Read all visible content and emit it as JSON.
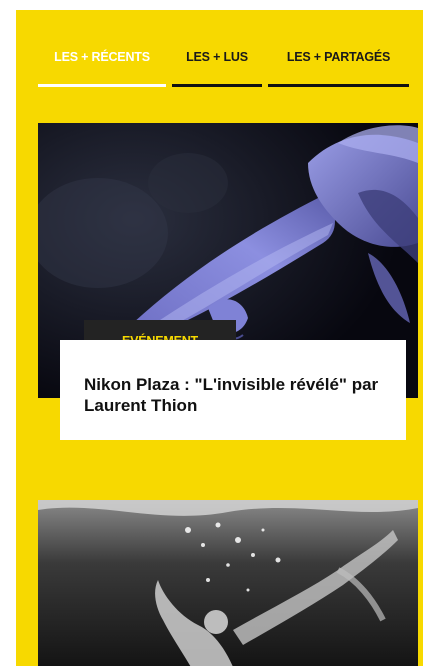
{
  "tabs": [
    {
      "label": "LES + RÉCENTS",
      "active": true
    },
    {
      "label": "LES + LUS",
      "active": false
    },
    {
      "label": "LES + PARTAGÉS",
      "active": false
    }
  ],
  "articles": [
    {
      "category": "EVÉNEMENT",
      "title": "Nikon Plaza : \"L'invisible révélé\" par Laurent Thion"
    }
  ],
  "colors": {
    "accent_yellow": "#f7d900",
    "dark": "#232323"
  }
}
